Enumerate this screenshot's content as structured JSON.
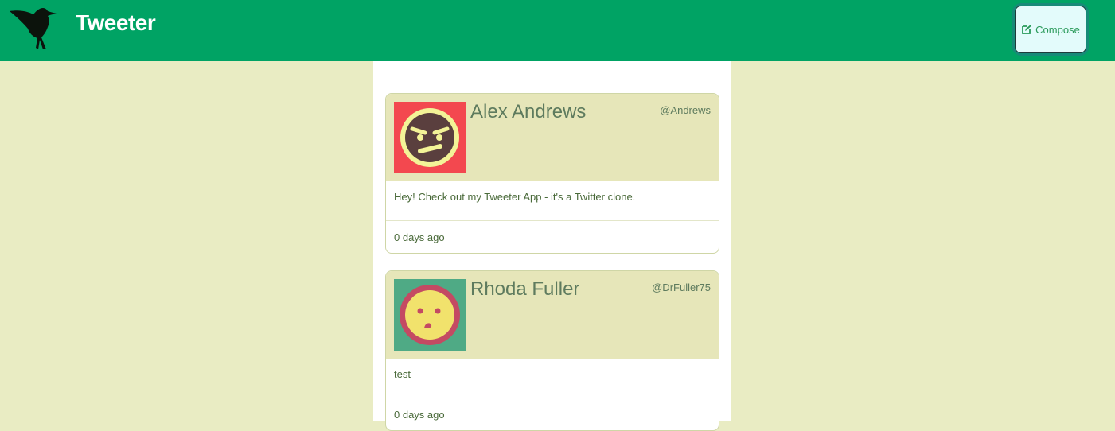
{
  "nav": {
    "brand": "Tweeter",
    "logo_icon": "hummingbird-icon",
    "compose_label": "Compose",
    "compose_icon": "edit-icon"
  },
  "colors": {
    "nav_bg": "#00a364",
    "page_bg": "#e9ecc3",
    "tweet_header_bg": "#e6e6b9",
    "text_green": "#5e7b5e",
    "compose_bg": "#e3fbfb"
  },
  "tweets": [
    {
      "name": "Alex Andrews",
      "handle": "@Andrews",
      "content": "Hey! Check out my Tweeter App - it's a Twitter clone.",
      "timestamp": "0 days ago",
      "avatar_icon": "angry-face-avatar-icon"
    },
    {
      "name": "Rhoda Fuller",
      "handle": "@DrFuller75",
      "content": "test",
      "timestamp": "0 days ago",
      "avatar_icon": "surprised-face-avatar-icon"
    }
  ]
}
